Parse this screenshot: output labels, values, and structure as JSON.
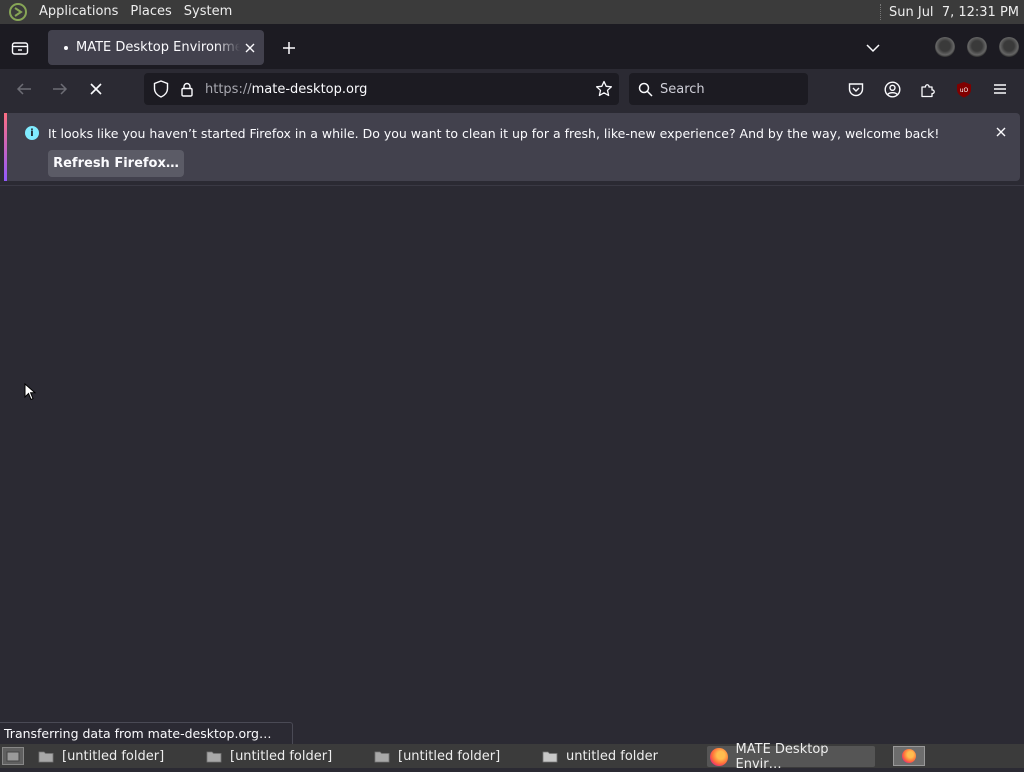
{
  "top_panel": {
    "menus": [
      "Applications",
      "Places",
      "System"
    ],
    "clock": "Sun Jul  7, 12:31 PM"
  },
  "browser": {
    "tab": {
      "title": "MATE Desktop Environment"
    },
    "url": {
      "scheme": "https://",
      "host": "mate-desktop.org"
    },
    "search_placeholder": "Search",
    "notification": {
      "message": "It looks like you haven’t started Firefox in a while. Do you want to clean it up for a fresh, like-new experience? And by the way, welcome back!",
      "button_label": "Refresh Firefox…"
    },
    "status_text": "Transferring data from mate-desktop.org…",
    "colors": {
      "accent_info": "#80ebff",
      "toolbar": "#2b2a33",
      "tabstrip": "#1c1b22",
      "ublock": "#800000"
    }
  },
  "taskbar": {
    "tasks": [
      {
        "label": "[untitled folder]",
        "icon": "folder-icon"
      },
      {
        "label": "[untitled folder]",
        "icon": "folder-icon"
      },
      {
        "label": "[untitled folder]",
        "icon": "folder-icon"
      },
      {
        "label": "untitled folder",
        "icon": "folder-icon"
      },
      {
        "label": "MATE Desktop Envir…",
        "icon": "firefox-icon"
      }
    ]
  }
}
